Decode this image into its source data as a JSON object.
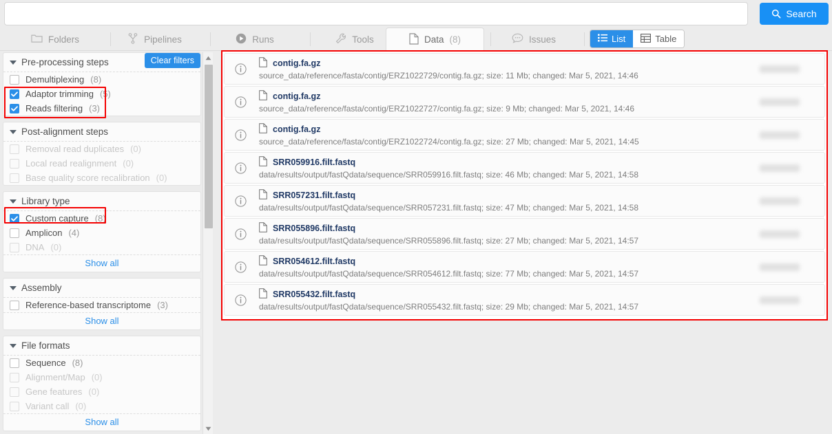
{
  "search": {
    "value": "",
    "placeholder": "",
    "button_label": "Search",
    "button_icon": "search-icon",
    "accent": "#1890f5"
  },
  "tabs": [
    {
      "label": "Folders",
      "icon": "folder-icon",
      "count": "",
      "active": false
    },
    {
      "label": "Pipelines",
      "icon": "pipeline-icon",
      "count": "",
      "active": false
    },
    {
      "label": "Runs",
      "icon": "play-icon",
      "count": "",
      "active": false
    },
    {
      "label": "Tools",
      "icon": "wrench-icon",
      "count": "",
      "active": false
    },
    {
      "label": "Data",
      "icon": "file-icon",
      "count": "(8)",
      "active": true
    },
    {
      "label": "Issues",
      "icon": "comment-icon",
      "count": "",
      "active": false
    }
  ],
  "view_toggle": {
    "list_label": "List",
    "list_icon": "list-icon",
    "table_label": "Table",
    "table_icon": "table-icon",
    "selected": "List",
    "active_color": "#2b8fe8"
  },
  "sidebar": {
    "clear_filters_label": "Clear filters",
    "show_all_label": "Show all",
    "facets": [
      {
        "title": "Pre-processing steps",
        "has_clear": true,
        "show_all": false,
        "items": [
          {
            "label": "Demultiplexing",
            "count": "(8)",
            "checked": false,
            "disabled": false
          },
          {
            "label": "Adaptor trimming",
            "count": "(5)",
            "checked": true,
            "disabled": false
          },
          {
            "label": "Reads filtering",
            "count": "(3)",
            "checked": true,
            "disabled": false
          }
        ]
      },
      {
        "title": "Post-alignment steps",
        "has_clear": false,
        "show_all": false,
        "items": [
          {
            "label": "Removal read duplicates",
            "count": "(0)",
            "checked": false,
            "disabled": true
          },
          {
            "label": "Local read realignment",
            "count": "(0)",
            "checked": false,
            "disabled": true
          },
          {
            "label": "Base quality score recalibration",
            "count": "(0)",
            "checked": false,
            "disabled": true
          }
        ]
      },
      {
        "title": "Library type",
        "has_clear": false,
        "show_all": true,
        "items": [
          {
            "label": "Custom capture",
            "count": "(8)",
            "checked": true,
            "disabled": false
          },
          {
            "label": "Amplicon",
            "count": "(4)",
            "checked": false,
            "disabled": false
          },
          {
            "label": "DNA",
            "count": "(0)",
            "checked": false,
            "disabled": true
          }
        ]
      },
      {
        "title": "Assembly",
        "has_clear": false,
        "show_all": true,
        "items": [
          {
            "label": "Reference-based transcriptome",
            "count": "(3)",
            "checked": false,
            "disabled": false
          }
        ]
      },
      {
        "title": "File formats",
        "has_clear": false,
        "show_all": true,
        "items": [
          {
            "label": "Sequence",
            "count": "(8)",
            "checked": false,
            "disabled": false
          },
          {
            "label": "Alignment/Map",
            "count": "(0)",
            "checked": false,
            "disabled": true
          },
          {
            "label": "Gene features",
            "count": "(0)",
            "checked": false,
            "disabled": true
          },
          {
            "label": "Variant call",
            "count": "(0)",
            "checked": false,
            "disabled": true
          }
        ]
      }
    ]
  },
  "results": {
    "rows": [
      {
        "name": "contig.fa.gz",
        "detail": "source_data/reference/fasta/contig/ERZ1022729/contig.fa.gz;  size: 11 Mb;  changed: Mar 5, 2021, 14:46"
      },
      {
        "name": "contig.fa.gz",
        "detail": "source_data/reference/fasta/contig/ERZ1022727/contig.fa.gz;  size: 9 Mb;  changed: Mar 5, 2021, 14:46"
      },
      {
        "name": "contig.fa.gz",
        "detail": "source_data/reference/fasta/contig/ERZ1022724/contig.fa.gz;  size: 27 Mb;  changed: Mar 5, 2021, 14:45"
      },
      {
        "name": "SRR059916.filt.fastq",
        "detail": "data/results/output/fastQdata/sequence/SRR059916.filt.fastq;  size: 46 Mb;  changed: Mar 5, 2021, 14:58"
      },
      {
        "name": "SRR057231.filt.fastq",
        "detail": "data/results/output/fastQdata/sequence/SRR057231.filt.fastq;  size: 47 Mb;  changed: Mar 5, 2021, 14:58"
      },
      {
        "name": "SRR055896.filt.fastq",
        "detail": "data/results/output/fastQdata/sequence/SRR055896.filt.fastq;  size: 27 Mb;  changed: Mar 5, 2021, 14:57"
      },
      {
        "name": "SRR054612.filt.fastq",
        "detail": "data/results/output/fastQdata/sequence/SRR054612.filt.fastq;  size: 77 Mb;  changed: Mar 5, 2021, 14:57"
      },
      {
        "name": "SRR055432.filt.fastq",
        "detail": "data/results/output/fastQdata/sequence/SRR055432.filt.fastq;  size: 29 Mb;  changed: Mar 5, 2021, 14:57"
      }
    ],
    "row_icon": "file-icon",
    "info_icon": "info-icon",
    "highlight_color": "#f40000"
  }
}
